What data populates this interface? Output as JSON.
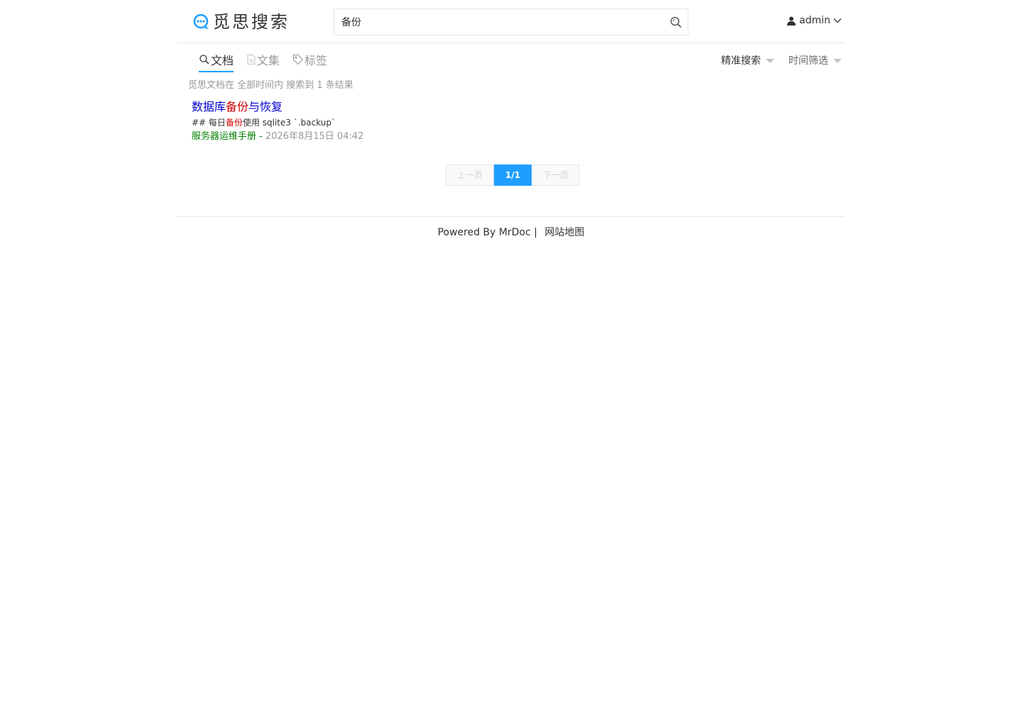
{
  "header": {
    "logo_text": "觅思搜索",
    "search": {
      "value": "备份",
      "placeholder": ""
    },
    "user": {
      "name": "admin"
    }
  },
  "tabs": [
    {
      "label": "文档",
      "active": true,
      "icon": "search-icon"
    },
    {
      "label": "文集",
      "active": false,
      "icon": "document-icon"
    },
    {
      "label": "标签",
      "active": false,
      "icon": "tag-icon"
    }
  ],
  "filters": {
    "exact": "精准搜索",
    "time": "时间筛选"
  },
  "summary": "觅思文档在 全部时间内 搜索到 1 条结果",
  "results": [
    {
      "title_pre": "数据库",
      "title_hl": "备份",
      "title_post": "与恢复",
      "snippet_pre": "## 每日",
      "snippet_hl": "备份",
      "snippet_post": "使用 sqlite3 `.backup`",
      "source": "服务器运维手册",
      "sep": " - ",
      "date": "2026年8月15日 04:42"
    }
  ],
  "pagination": {
    "prev": "上一页",
    "current": "1/1",
    "next": "下一页"
  },
  "footer": {
    "powered": "Powered By MrDoc",
    "separator": "|",
    "sitemap": "网站地图"
  },
  "colors": {
    "accent": "#1e9fff",
    "title_link": "#0000cc",
    "highlight": "#cc0000",
    "source": "#008000"
  }
}
